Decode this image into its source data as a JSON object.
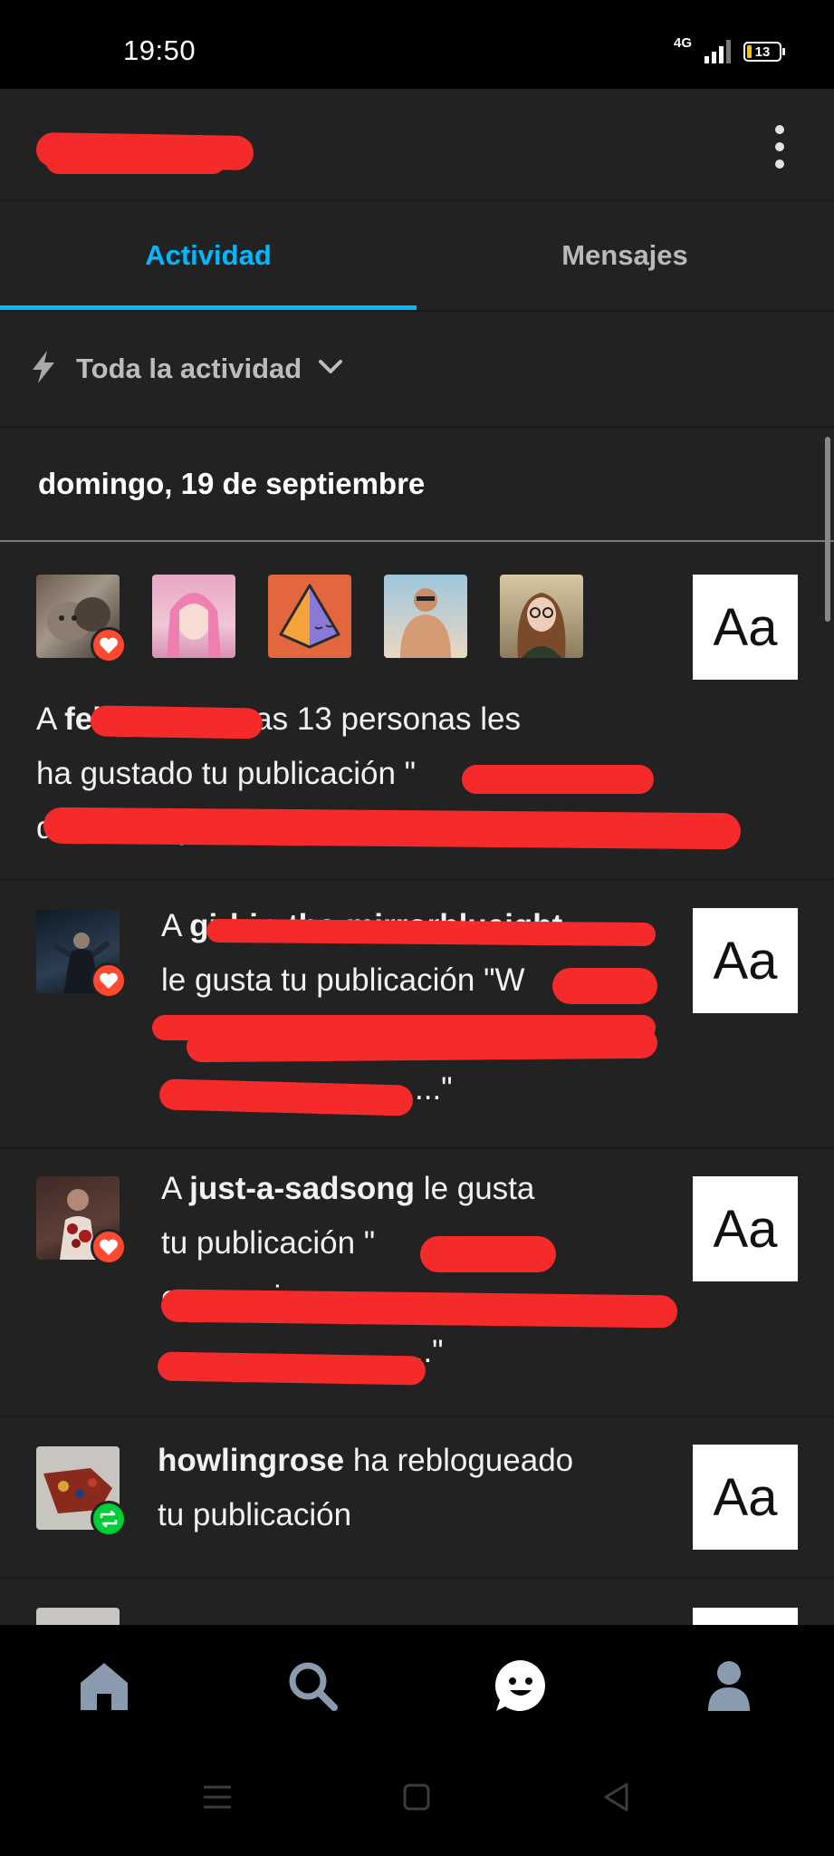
{
  "status_bar": {
    "time": "19:50",
    "network": "4G",
    "battery": "13"
  },
  "header": {
    "username": ""
  },
  "tabs": [
    {
      "label": "Actividad",
      "active": true
    },
    {
      "label": "Mensajes",
      "active": false
    }
  ],
  "filter": {
    "label": "Toda la actividad",
    "icon": "lightning-icon"
  },
  "date_header": "domingo, 19 de septiembre",
  "notifications": [
    {
      "type": "like-group",
      "prefix": "A ",
      "user": "felin ine",
      "line1_rest": " y otras 13 personas les",
      "line2": "ha gustado tu publicación \"",
      "line3": "dishonestly ...\"",
      "thumb": "Aa"
    },
    {
      "type": "like",
      "prefix": "A ",
      "user": "girl-in-the-mirrorblueight",
      "line2": "le gusta tu publicación \"W",
      "line4": "...\"",
      "thumb": "Aa"
    },
    {
      "type": "like",
      "prefix": "A ",
      "user": "just-a-sadsong",
      "line1_rest": " le gusta",
      "line2": "tu publicación \"",
      "line3": "compani",
      "line4": "...\"",
      "thumb": "Aa"
    },
    {
      "type": "reblog",
      "user": "howlingrose",
      "line1_rest": " ha reblogueado",
      "line2": "tu publicación",
      "thumb": "Aa"
    }
  ],
  "colors": {
    "accent": "#00b8ff",
    "like": "#ff4930",
    "reblog": "#00cf35",
    "background": "#222222",
    "redaction": "#f52a2a"
  },
  "bottom_nav": [
    "home-icon",
    "search-icon",
    "activity-smiley-icon",
    "account-icon"
  ],
  "system_nav": [
    "menu-icon",
    "home-square-icon",
    "back-icon"
  ]
}
